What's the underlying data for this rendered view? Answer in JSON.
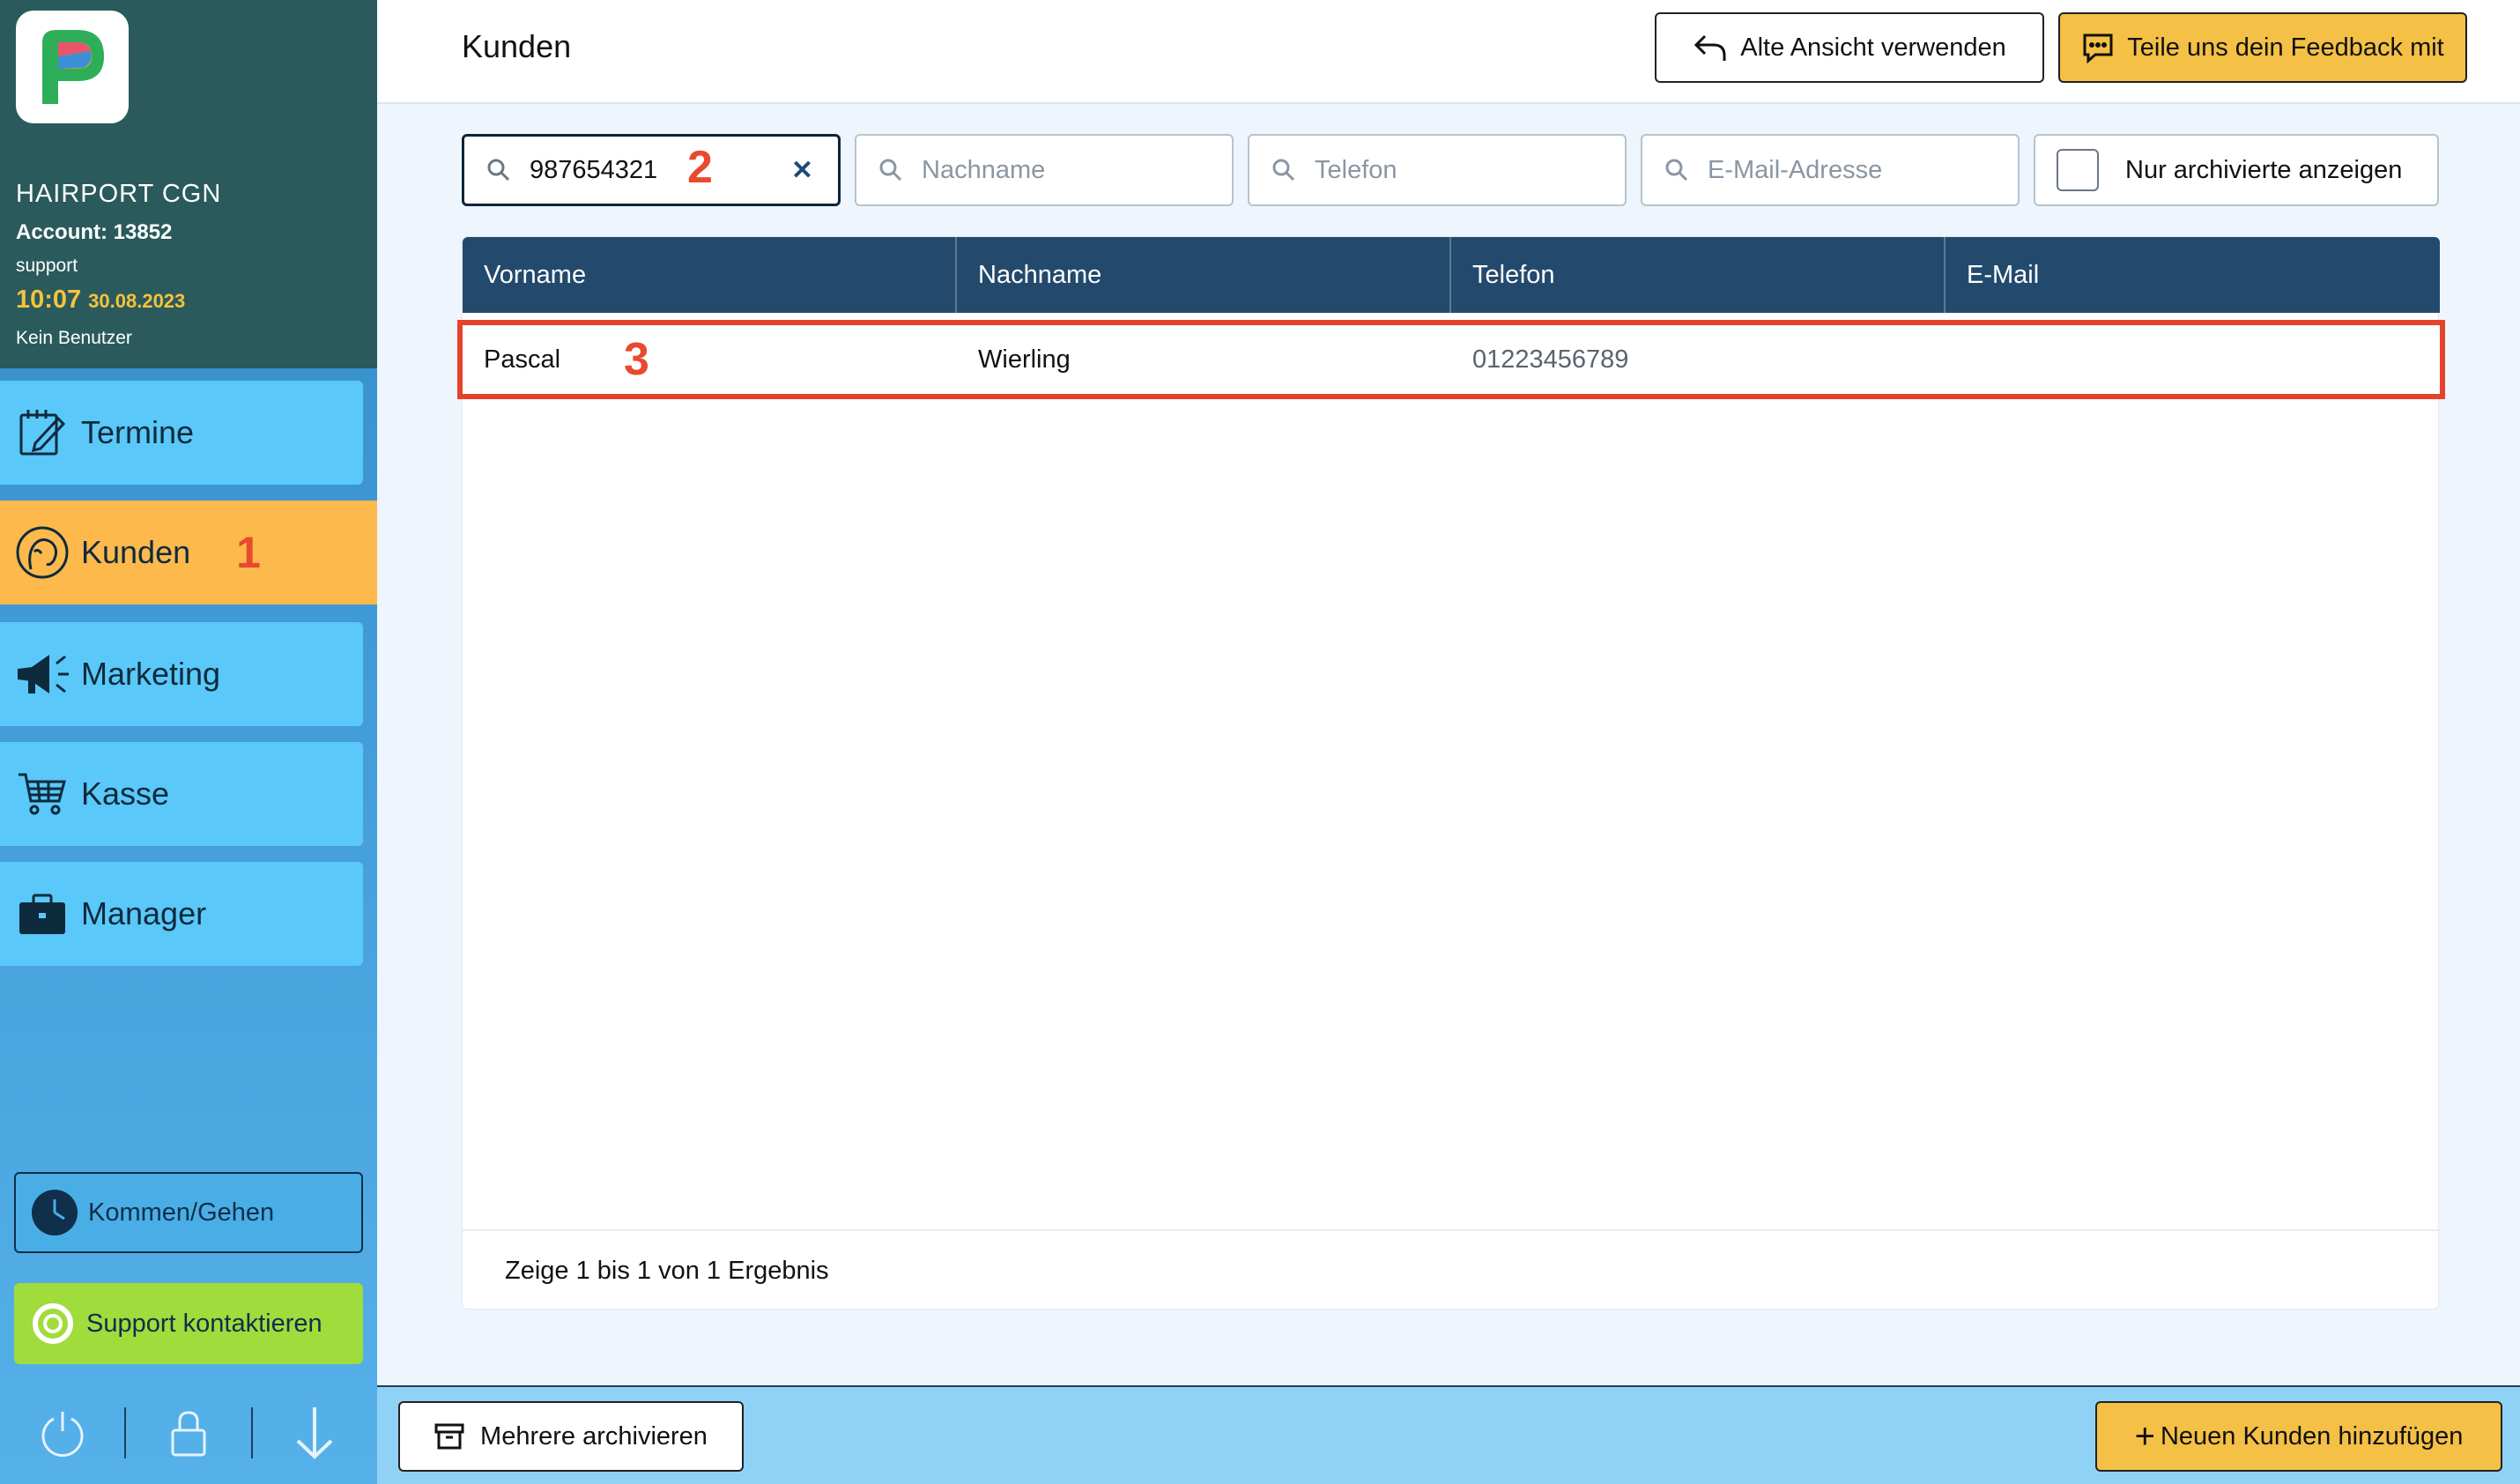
{
  "account": {
    "name": "HAIRPORT CGN",
    "number": "Account: 13852",
    "user": "support",
    "time": "10:07",
    "date": "30.08.2023",
    "no_user": "Kein Benutzer"
  },
  "nav": [
    {
      "label": "Termine",
      "icon": "calendar-edit-icon"
    },
    {
      "label": "Kunden",
      "icon": "customer-head-icon",
      "active": true,
      "badge": "1"
    },
    {
      "label": "Marketing",
      "icon": "megaphone-icon"
    },
    {
      "label": "Kasse",
      "icon": "shopping-cart-icon"
    },
    {
      "label": "Manager",
      "icon": "briefcase-icon"
    }
  ],
  "sidebar_buttons": {
    "kommen_gehen": "Kommen/Gehen",
    "support": "Support kontaktieren"
  },
  "header": {
    "title": "Kunden",
    "old_view_label": "Alte Ansicht verwenden",
    "feedback_label": "Teile uns dein Feedback mit"
  },
  "filters": {
    "vorname": {
      "value": "987654321",
      "badge": "2"
    },
    "nachname": {
      "placeholder": "Nachname"
    },
    "telefon": {
      "placeholder": "Telefon"
    },
    "email": {
      "placeholder": "E-Mail-Adresse"
    },
    "archived_label": "Nur archivierte anzeigen"
  },
  "table": {
    "columns": [
      "Vorname",
      "Nachname",
      "Telefon",
      "E-Mail"
    ],
    "rows": [
      {
        "vorname": "Pascal",
        "nachname": "Wierling",
        "telefon": "01223456789",
        "email": "",
        "badge": "3"
      }
    ],
    "footer": "Zeige 1 bis 1 von 1 Ergebnis"
  },
  "bottom": {
    "archive_label": "Mehrere archivieren",
    "add_label": "Neuen Kunden hinzufügen"
  },
  "colors": {
    "sidebar_top": "#2a5a5c",
    "nav_item": "#5ac8f8",
    "nav_active": "#fdb94c",
    "accent_yellow": "#f4c045",
    "table_header": "#234a6d",
    "highlight_red": "#e5422b",
    "support_green": "#9fdc3c"
  }
}
